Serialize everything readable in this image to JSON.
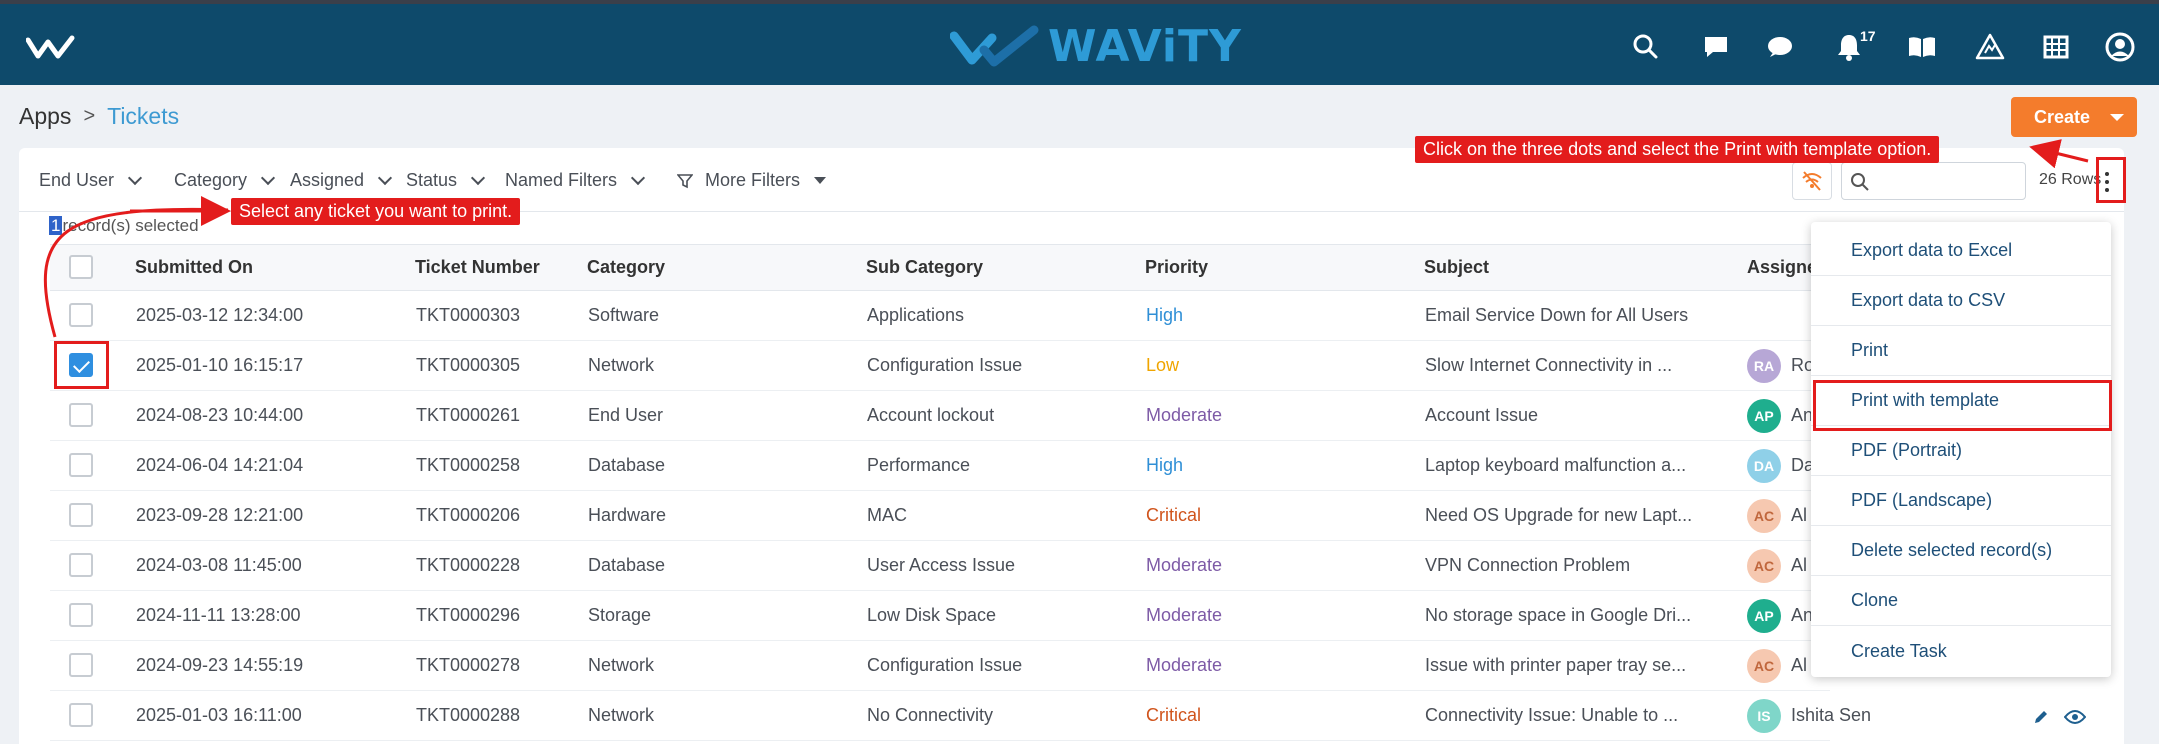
{
  "header": {
    "brand": "WAViTY",
    "notification_count": "17",
    "icons": [
      "menu-logo-icon",
      "search-icon",
      "chat-icon",
      "comment-icon",
      "bell-icon",
      "book-icon",
      "warning-icon",
      "grid-icon",
      "user-icon"
    ],
    "colors": {
      "bar": "#0e4a6b",
      "brand": "#2e9bd6"
    }
  },
  "breadcrumb": {
    "root": "Apps",
    "separator": ">",
    "current": "Tickets"
  },
  "create_button": {
    "label": "Create",
    "color": "#f47c2c"
  },
  "filters": [
    "End User",
    "Category",
    "Assigned",
    "Status",
    "Named Filters",
    "More Filters"
  ],
  "toolbar": {
    "search_placeholder": "",
    "rows_count": "26 Rows"
  },
  "selection": {
    "count": "1",
    "text": "record(s) selected"
  },
  "table": {
    "columns": [
      "Submitted On",
      "Ticket Number",
      "Category",
      "Sub Category",
      "Priority",
      "Subject",
      "Assigned"
    ],
    "rows": [
      {
        "checked": false,
        "submitted": "2025-03-12 12:34:00",
        "ticket": "TKT0000303",
        "category": "Software",
        "sub": "Applications",
        "priority": "High",
        "subject": "Email Service Down for All Users",
        "initials": "",
        "assignee": ""
      },
      {
        "checked": true,
        "submitted": "2025-01-10 16:15:17",
        "ticket": "TKT0000305",
        "category": "Network",
        "sub": "Configuration Issue",
        "priority": "Low",
        "subject": "Slow Internet Connectivity in ...",
        "initials": "RA",
        "assignee": "Ro"
      },
      {
        "checked": false,
        "submitted": "2024-08-23 10:44:00",
        "ticket": "TKT0000261",
        "category": "End User",
        "sub": "Account lockout",
        "priority": "Moderate",
        "subject": "Account Issue",
        "initials": "AP",
        "assignee": "An"
      },
      {
        "checked": false,
        "submitted": "2024-06-04 14:21:04",
        "ticket": "TKT0000258",
        "category": "Database",
        "sub": "Performance",
        "priority": "High",
        "subject": "Laptop keyboard malfunction a...",
        "initials": "DA",
        "assignee": "Da"
      },
      {
        "checked": false,
        "submitted": "2023-09-28 12:21:00",
        "ticket": "TKT0000206",
        "category": "Hardware",
        "sub": "MAC",
        "priority": "Critical",
        "subject": "Need OS Upgrade for new Lapt...",
        "initials": "AC",
        "assignee": "Al"
      },
      {
        "checked": false,
        "submitted": "2024-03-08 11:45:00",
        "ticket": "TKT0000228",
        "category": "Database",
        "sub": "User Access Issue",
        "priority": "Moderate",
        "subject": "VPN Connection Problem",
        "initials": "AC",
        "assignee": "Al"
      },
      {
        "checked": false,
        "submitted": "2024-11-11 13:28:00",
        "ticket": "TKT0000296",
        "category": "Storage",
        "sub": "Low Disk Space",
        "priority": "Moderate",
        "subject": "No storage space in Google Dri...",
        "initials": "AP",
        "assignee": "An"
      },
      {
        "checked": false,
        "submitted": "2024-09-23 14:55:19",
        "ticket": "TKT0000278",
        "category": "Network",
        "sub": "Configuration Issue",
        "priority": "Moderate",
        "subject": "Issue with printer paper tray se...",
        "initials": "AC",
        "assignee": "Al"
      },
      {
        "checked": false,
        "submitted": "2025-01-03 16:11:00",
        "ticket": "TKT0000288",
        "category": "Network",
        "sub": "No Connectivity",
        "priority": "Critical",
        "subject": "Connectivity Issue: Unable to ...",
        "initials": "IS",
        "assignee": "Ishita Sen"
      }
    ]
  },
  "priority_colors": {
    "High": "#2f8fd6",
    "Low": "#f0a500",
    "Moderate": "#7d5aa6",
    "Critical": "#d0541c"
  },
  "avatar_colors": {
    "RA": "#b7a7d6",
    "AP": "#1fae8e",
    "DA": "#8fd0e8",
    "AC": "#f6c8b0",
    "IS": "#7fd6c9"
  },
  "avatar_text_colors": {
    "RA": "#ffffff",
    "AP": "#ffffff",
    "DA": "#ffffff",
    "AC": "#c0673d",
    "IS": "#ffffff"
  },
  "menu": {
    "items": [
      "Export data to Excel",
      "Export data to CSV",
      "Print",
      "Print with template",
      "PDF (Portrait)",
      "PDF (Landscape)",
      "Delete selected record(s)",
      "Clone",
      "Create Task"
    ]
  },
  "annotations": {
    "select_ticket": "Select any ticket you want to print.",
    "three_dots": "Click on the three dots and select the Print with template option.",
    "color": "#e31c1c"
  }
}
